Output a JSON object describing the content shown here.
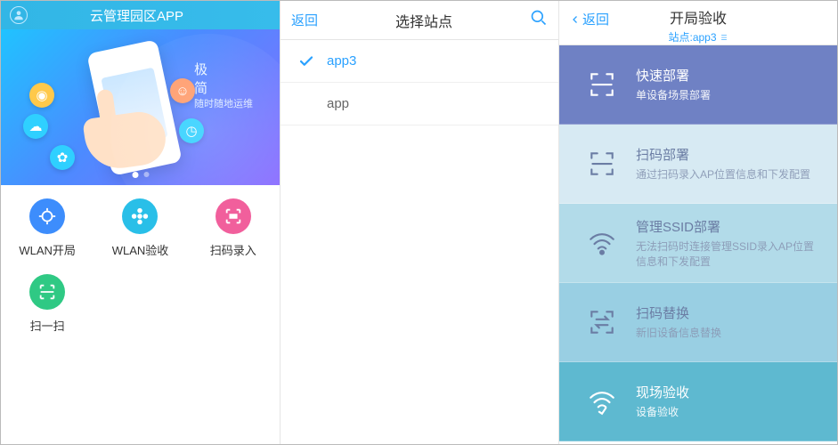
{
  "panel1": {
    "title": "云管理园区APP",
    "hero_tag_line1": "极",
    "hero_tag_line2": "简",
    "hero_tag_sub": "随时随地运维",
    "grid": [
      {
        "label": "WLAN开局"
      },
      {
        "label": "WLAN验收"
      },
      {
        "label": "扫码录入"
      },
      {
        "label": "扫一扫"
      }
    ]
  },
  "panel2": {
    "back": "返回",
    "title": "选择站点",
    "sites": [
      {
        "name": "app3",
        "selected": true
      },
      {
        "name": "app",
        "selected": false
      }
    ]
  },
  "panel3": {
    "back": "返回",
    "title": "开局验收",
    "subtitle": "站点:app3",
    "cards": [
      {
        "title": "快速部署",
        "sub": "单设备场景部署"
      },
      {
        "title": "扫码部署",
        "sub": "通过扫码录入AP位置信息和下发配置"
      },
      {
        "title": "管理SSID部署",
        "sub": "无法扫码时连接管理SSID录入AP位置信息和下发配置"
      },
      {
        "title": "扫码替换",
        "sub": "新旧设备信息替换"
      },
      {
        "title": "现场验收",
        "sub": "设备验收"
      }
    ]
  }
}
